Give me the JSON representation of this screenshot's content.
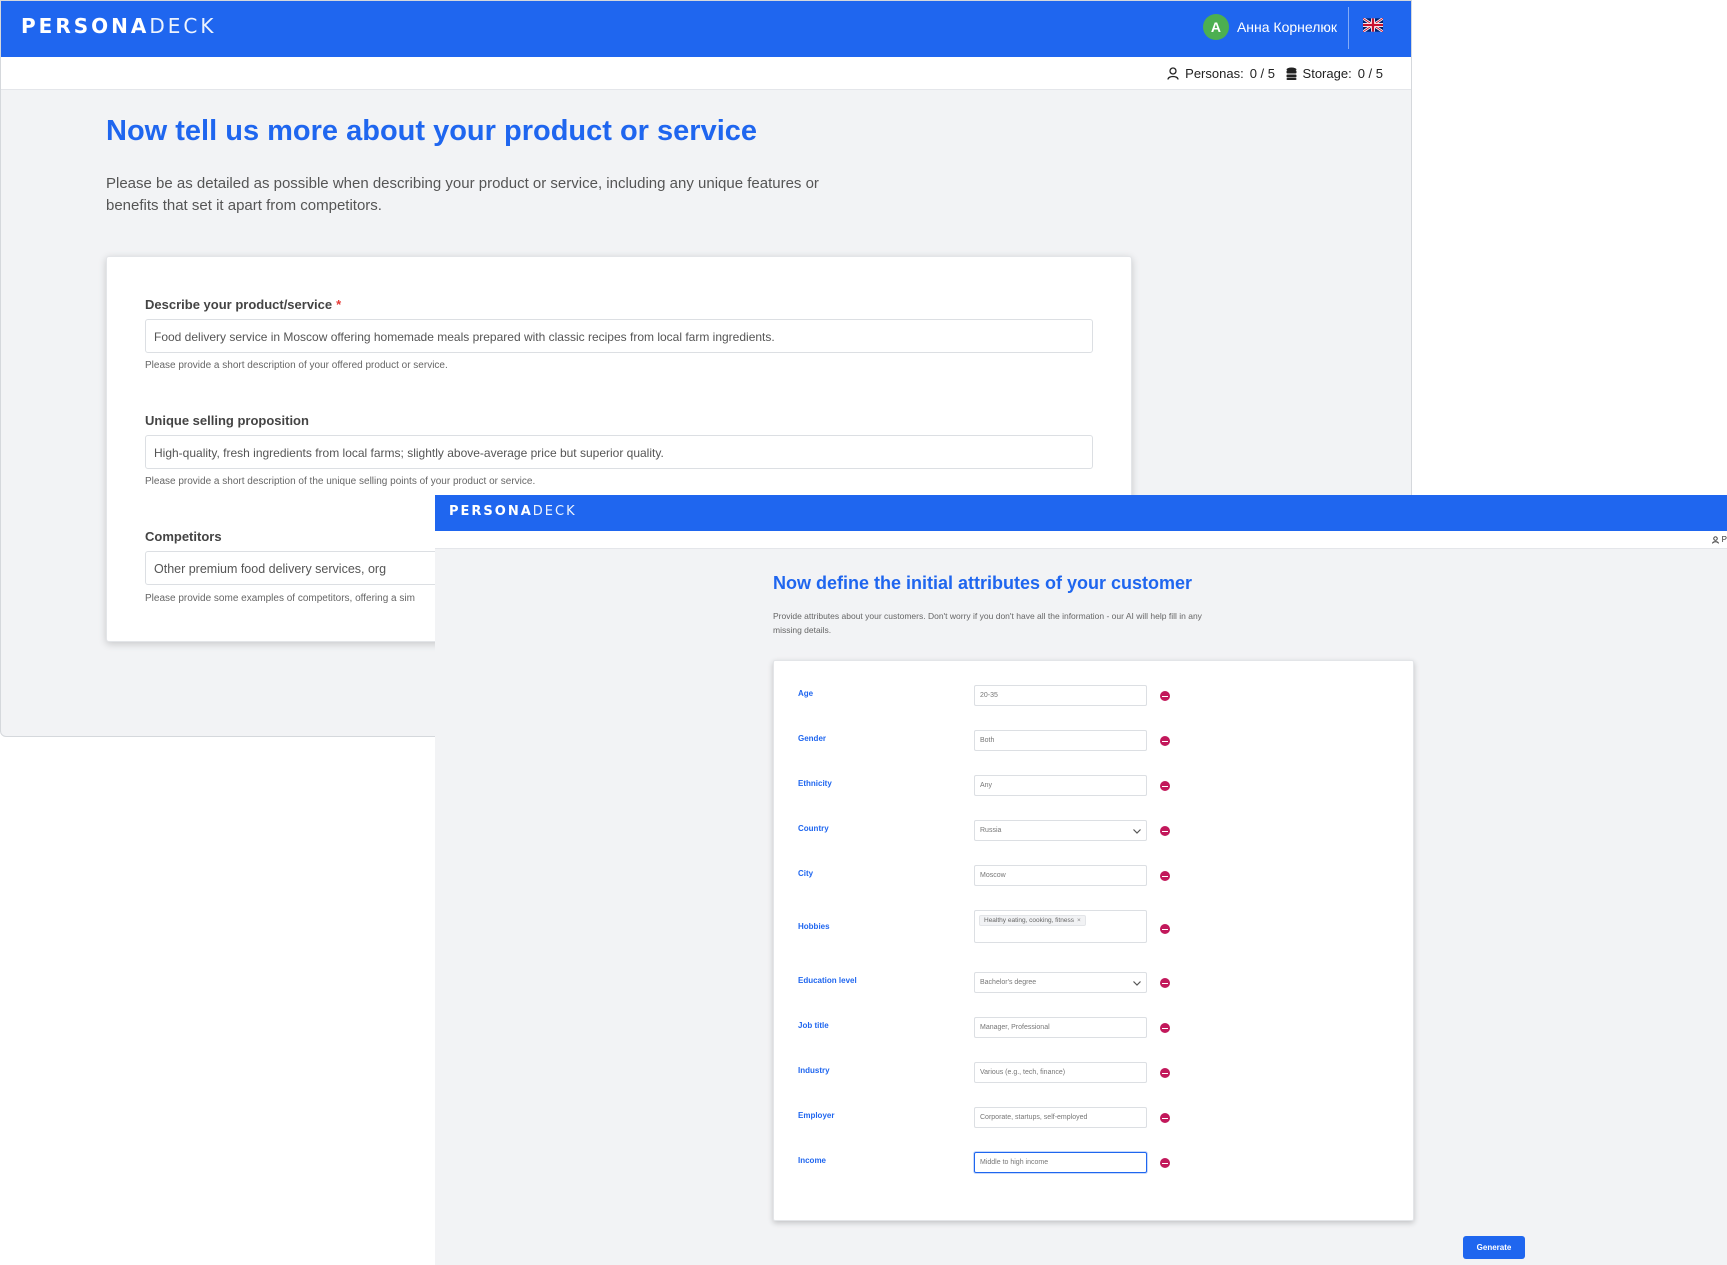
{
  "back_window": {
    "logo": {
      "bold": "PERSONA",
      "light": "DECK"
    },
    "user": {
      "avatar_letter": "A",
      "name": "Анна Корнелюк"
    },
    "language_icon": "uk-flag-icon",
    "stats": {
      "personas_label": "Personas:",
      "personas_value": "0 / 5",
      "storage_label": "Storage:",
      "storage_value": "0 / 5"
    },
    "heading": "Now tell us more about your product or service",
    "lead": "Please be as detailed as possible when describing your product or service, including any unique features or benefits that set it apart from competitors.",
    "fields": {
      "product": {
        "label": "Describe your product/service",
        "required_mark": "*",
        "value": "Food delivery service in Moscow offering homemade meals prepared with classic recipes from local farm ingredients.",
        "help": "Please provide a short description of your offered product or service."
      },
      "usp": {
        "label": "Unique selling proposition",
        "value": "High-quality, fresh ingredients from local farms; slightly above-average price but superior quality.",
        "help": "Please provide a short description of the unique selling points of your product or service."
      },
      "competitors": {
        "label": "Competitors",
        "value": "Other premium food delivery services, org",
        "help": "Please provide some examples of competitors, offering a sim"
      }
    }
  },
  "front_window": {
    "logo": {
      "bold": "PERSONA",
      "light": "DECK"
    },
    "stats_partial": "P",
    "heading": "Now define the initial attributes of your customer",
    "lead": "Provide attributes about your customers. Don't worry if you don't have all the information - our AI will help fill in any missing details.",
    "attributes": {
      "age": {
        "label": "Age",
        "value": "20-35"
      },
      "gender": {
        "label": "Gender",
        "value": "Both"
      },
      "ethnicity": {
        "label": "Ethnicity",
        "value": "Any"
      },
      "country": {
        "label": "Country",
        "value": "Russia"
      },
      "city": {
        "label": "City",
        "value": "Moscow"
      },
      "hobbies": {
        "label": "Hobbies",
        "chip": "Healthy eating, cooking, fitness",
        "chip_remove": "×"
      },
      "education": {
        "label": "Education level",
        "value": "Bachelor's degree"
      },
      "job_title": {
        "label": "Job title",
        "value": "Manager, Professional"
      },
      "industry": {
        "label": "Industry",
        "value": "Various (e.g., tech, finance)"
      },
      "employer": {
        "label": "Employer",
        "value": "Corporate, startups, self-employed"
      },
      "income": {
        "label": "Income",
        "value": "Middle to high income"
      }
    },
    "generate_button": "Generate"
  },
  "colors": {
    "brand": "#1f66ef",
    "remove": "#c2185b",
    "avatar": "#4caf50"
  }
}
